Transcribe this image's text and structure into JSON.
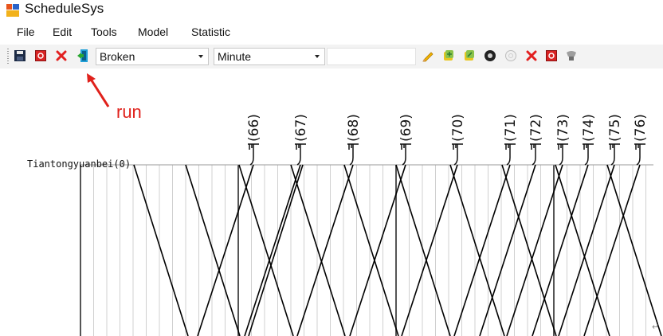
{
  "window": {
    "title": "ScheduleSys"
  },
  "menu": [
    "File",
    "Edit",
    "Tools",
    "Model",
    "Statistic"
  ],
  "toolbar": {
    "mode_select": {
      "value": "Broken"
    },
    "unit_select": {
      "value": "Minute"
    },
    "search_text": {
      "value": ""
    },
    "icons": [
      "save-icon",
      "stop-icon",
      "delete-icon",
      "run-icon",
      "pencil-icon",
      "add-icon",
      "edit-icon",
      "record-icon",
      "clear-icon",
      "close-icon",
      "stop-icon",
      "brush-icon"
    ]
  },
  "annotation": {
    "label": "run",
    "color": "#e0211b"
  },
  "diagram": {
    "station": "Tiantongyuanbei(0)",
    "trains": [
      "(66)",
      "(67)",
      "(68)",
      "(69)",
      "(70)",
      "(71)",
      "(72)",
      "(73)",
      "(74)",
      "(75)",
      "(76)"
    ]
  }
}
